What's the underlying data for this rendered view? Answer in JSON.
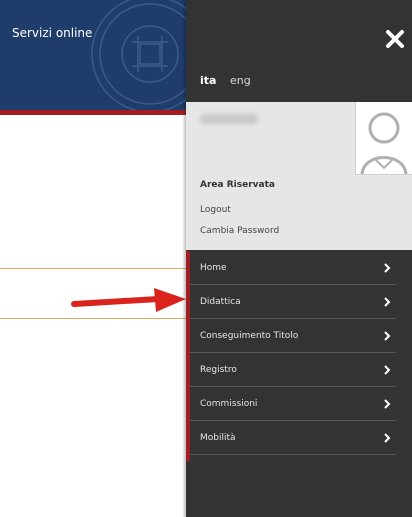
{
  "header": {
    "title": "Servizi online"
  },
  "drawer": {
    "close_icon": "close-icon",
    "languages": {
      "active": "ita",
      "other": "eng"
    },
    "user_panel": {
      "area_title": "Area Riservata",
      "links": [
        "Logout",
        "Cambia Password"
      ],
      "avatar_icon": "user-avatar-icon"
    },
    "menu": {
      "items": [
        {
          "label": "Home"
        },
        {
          "label": "Didattica"
        },
        {
          "label": "Conseguimento Titolo"
        },
        {
          "label": "Registro"
        },
        {
          "label": "Commissioni"
        },
        {
          "label": "Mobilità"
        }
      ],
      "chevron_icon": "chevron-right-icon"
    }
  },
  "colors": {
    "header_bg": "#1f3c6b",
    "accent_red": "#a31e22",
    "drawer_bg": "#333333",
    "user_panel_bg": "#e6e6e6",
    "divider_gold": "#e0b062"
  }
}
